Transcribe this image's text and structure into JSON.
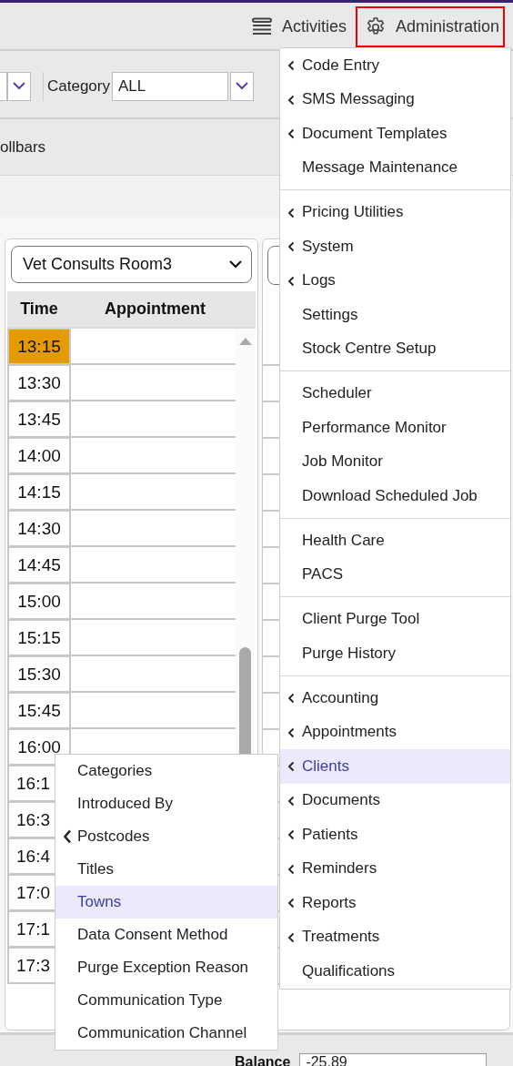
{
  "header": {
    "actions": [
      {
        "kind": "list",
        "label": "Activities",
        "selected": false
      },
      {
        "kind": "gear",
        "label": "Administration",
        "selected": true
      }
    ]
  },
  "filter_bar": {
    "category": {
      "label": "Category",
      "value": "ALL"
    }
  },
  "toolbar": {
    "label": "ollbars"
  },
  "schedule": {
    "room": "Vet Consults Room3",
    "columns": [
      "Time",
      "Appointment"
    ],
    "rows": [
      {
        "time": "13:15",
        "selected": true
      },
      {
        "time": "13:30",
        "selected": false
      },
      {
        "time": "13:45",
        "selected": false
      },
      {
        "time": "14:00",
        "selected": false
      },
      {
        "time": "14:15",
        "selected": false
      },
      {
        "time": "14:30",
        "selected": false
      },
      {
        "time": "14:45",
        "selected": false
      },
      {
        "time": "15:00",
        "selected": false
      },
      {
        "time": "15:15",
        "selected": false
      },
      {
        "time": "15:30",
        "selected": false
      },
      {
        "time": "15:45",
        "selected": false
      },
      {
        "time": "16:00",
        "selected": false
      },
      {
        "time": "16:1",
        "selected": false
      },
      {
        "time": "16:3",
        "selected": false
      },
      {
        "time": "16:4",
        "selected": false
      },
      {
        "time": "17:0",
        "selected": false
      },
      {
        "time": "17:1",
        "selected": false
      },
      {
        "time": "17:3",
        "selected": false
      }
    ]
  },
  "admin_menu": {
    "groups": [
      [
        {
          "label": "Code Entry",
          "has_submenu": true,
          "selected": false
        },
        {
          "label": "SMS Messaging",
          "has_submenu": true,
          "selected": false
        },
        {
          "label": "Document Templates",
          "has_submenu": true,
          "selected": false
        },
        {
          "label": "Message Maintenance",
          "has_submenu": false,
          "selected": false
        }
      ],
      [
        {
          "label": "Pricing Utilities",
          "has_submenu": true,
          "selected": false
        },
        {
          "label": "System",
          "has_submenu": true,
          "selected": false
        },
        {
          "label": "Logs",
          "has_submenu": true,
          "selected": false
        },
        {
          "label": "Settings",
          "has_submenu": false,
          "selected": false
        },
        {
          "label": "Stock Centre Setup",
          "has_submenu": false,
          "selected": false
        }
      ],
      [
        {
          "label": "Scheduler",
          "has_submenu": false,
          "selected": false
        },
        {
          "label": "Performance Monitor",
          "has_submenu": false,
          "selected": false
        },
        {
          "label": "Job Monitor",
          "has_submenu": false,
          "selected": false
        },
        {
          "label": "Download Scheduled Job",
          "has_submenu": false,
          "selected": false
        }
      ],
      [
        {
          "label": "Health Care",
          "has_submenu": false,
          "selected": false
        },
        {
          "label": "PACS",
          "has_submenu": false,
          "selected": false
        }
      ],
      [
        {
          "label": "Client Purge Tool",
          "has_submenu": false,
          "selected": false
        },
        {
          "label": "Purge History",
          "has_submenu": false,
          "selected": false
        }
      ],
      [
        {
          "label": "Accounting",
          "has_submenu": true,
          "selected": false
        },
        {
          "label": "Appointments",
          "has_submenu": true,
          "selected": false
        },
        {
          "label": "Clients",
          "has_submenu": true,
          "selected": true
        },
        {
          "label": "Documents",
          "has_submenu": true,
          "selected": false
        },
        {
          "label": "Patients",
          "has_submenu": true,
          "selected": false
        },
        {
          "label": "Reminders",
          "has_submenu": true,
          "selected": false
        },
        {
          "label": "Reports",
          "has_submenu": true,
          "selected": false
        },
        {
          "label": "Treatments",
          "has_submenu": true,
          "selected": false
        },
        {
          "label": "Qualifications",
          "has_submenu": false,
          "selected": false
        }
      ]
    ]
  },
  "clients_submenu": {
    "items": [
      {
        "kind": "command",
        "label": "Categories",
        "selected": false
      },
      {
        "kind": "command",
        "label": "Introduced By",
        "selected": false
      },
      {
        "kind": "submenu",
        "label": "Postcodes",
        "selected": false
      },
      {
        "kind": "command",
        "label": "Titles",
        "selected": false
      },
      {
        "kind": "command",
        "label": "Towns",
        "selected": true
      },
      {
        "kind": "command",
        "label": "Data Consent Method",
        "selected": false
      },
      {
        "kind": "command",
        "label": "Purge Exception Reason",
        "selected": false
      },
      {
        "kind": "command",
        "label": "Communication Type",
        "selected": false
      },
      {
        "kind": "command",
        "label": "Communication Channel",
        "selected": false
      }
    ]
  },
  "footer": {
    "balance": {
      "label": "Balance",
      "value": "-25.89"
    }
  }
}
